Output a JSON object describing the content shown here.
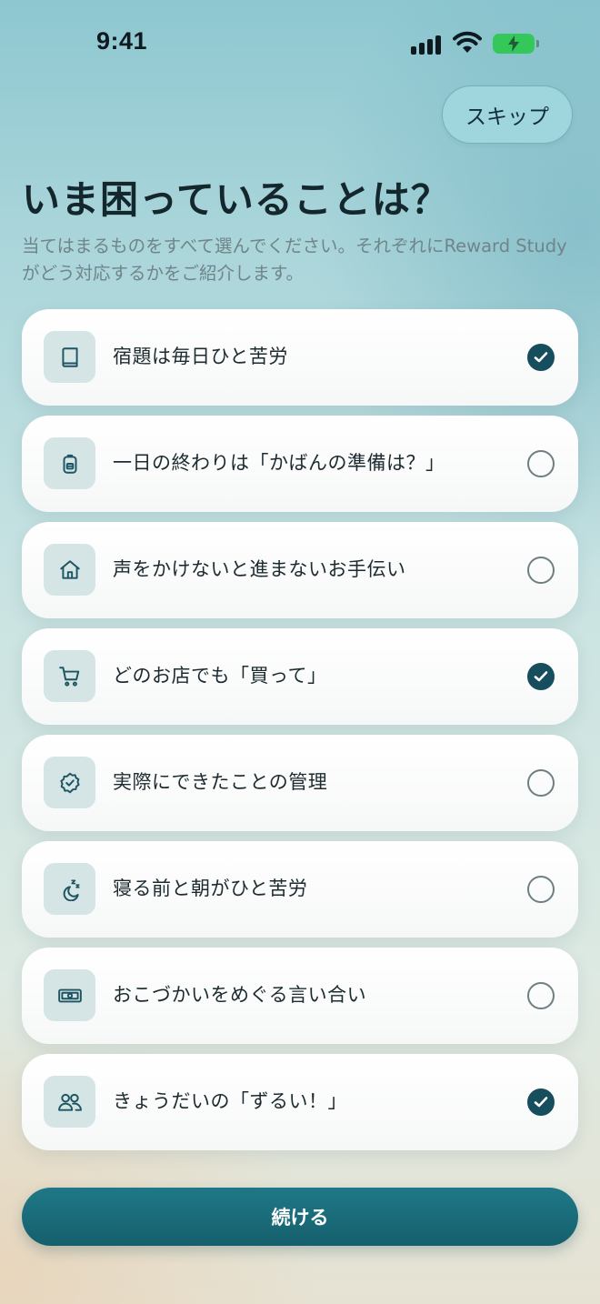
{
  "status_bar": {
    "time": "9:41"
  },
  "header": {
    "skip_label": "スキップ"
  },
  "title": "いま困っていることは？",
  "subtitle": "当てはまるものをすべて選んでください。それぞれにReward Studyがどう対応するかをご紹介します。",
  "options": [
    {
      "label": "宿題は毎日ひと苦労",
      "icon": "book-icon",
      "selected": true
    },
    {
      "label": "一日の終わりは「かばんの準備は？」",
      "icon": "backpack-icon",
      "selected": false
    },
    {
      "label": "声をかけないと進まないお手伝い",
      "icon": "home-icon",
      "selected": false
    },
    {
      "label": "どのお店でも「買って」",
      "icon": "cart-icon",
      "selected": true
    },
    {
      "label": "実際にできたことの管理",
      "icon": "badge-check-icon",
      "selected": false
    },
    {
      "label": "寝る前と朝がひと苦労",
      "icon": "moon-sleep-icon",
      "selected": false
    },
    {
      "label": "おこづかいをめぐる言い合い",
      "icon": "banknote-icon",
      "selected": false
    },
    {
      "label": "きょうだいの「ずるい！」",
      "icon": "users-icon",
      "selected": true
    }
  ],
  "footer": {
    "continue_label": "続ける"
  },
  "colors": {
    "accent": "#164e5d",
    "button": "#1a6b79",
    "skip_bg": "#9fd6de"
  }
}
